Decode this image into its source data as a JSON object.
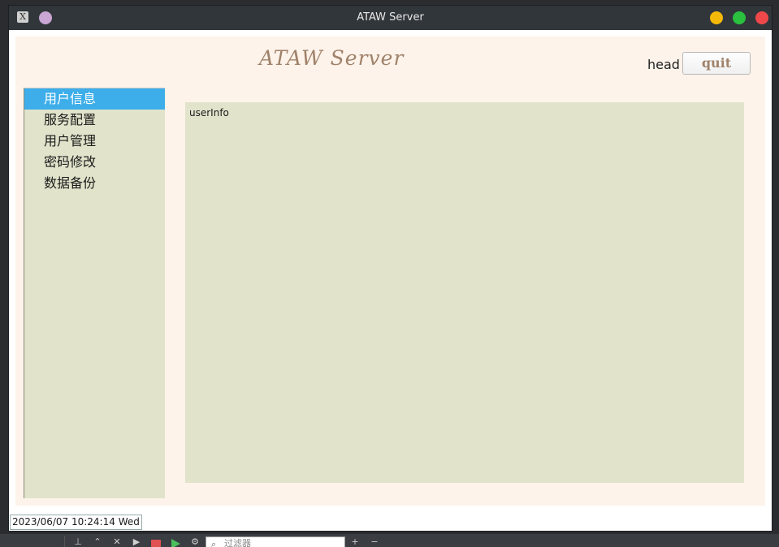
{
  "window": {
    "title": "ATAW Server"
  },
  "header": {
    "app_title": "ATAW  Server",
    "head_label": "head",
    "quit_label": "quit"
  },
  "sidebar": {
    "items": [
      {
        "label": "用户信息",
        "active": true
      },
      {
        "label": "服务配置"
      },
      {
        "label": "用户管理"
      },
      {
        "label": "密码修改"
      },
      {
        "label": "数据备份"
      }
    ]
  },
  "main": {
    "label": "userInfo"
  },
  "status": {
    "datetime": "2023/06/07 10:24:14 Wed"
  },
  "taskbar": {
    "filter_placeholder": "过滤器"
  },
  "colors": {
    "title_accent": "#a0826a",
    "active_item": "#3daee9",
    "panel_bg": "#e1e4cb",
    "content_bg": "#fdf3ea"
  }
}
